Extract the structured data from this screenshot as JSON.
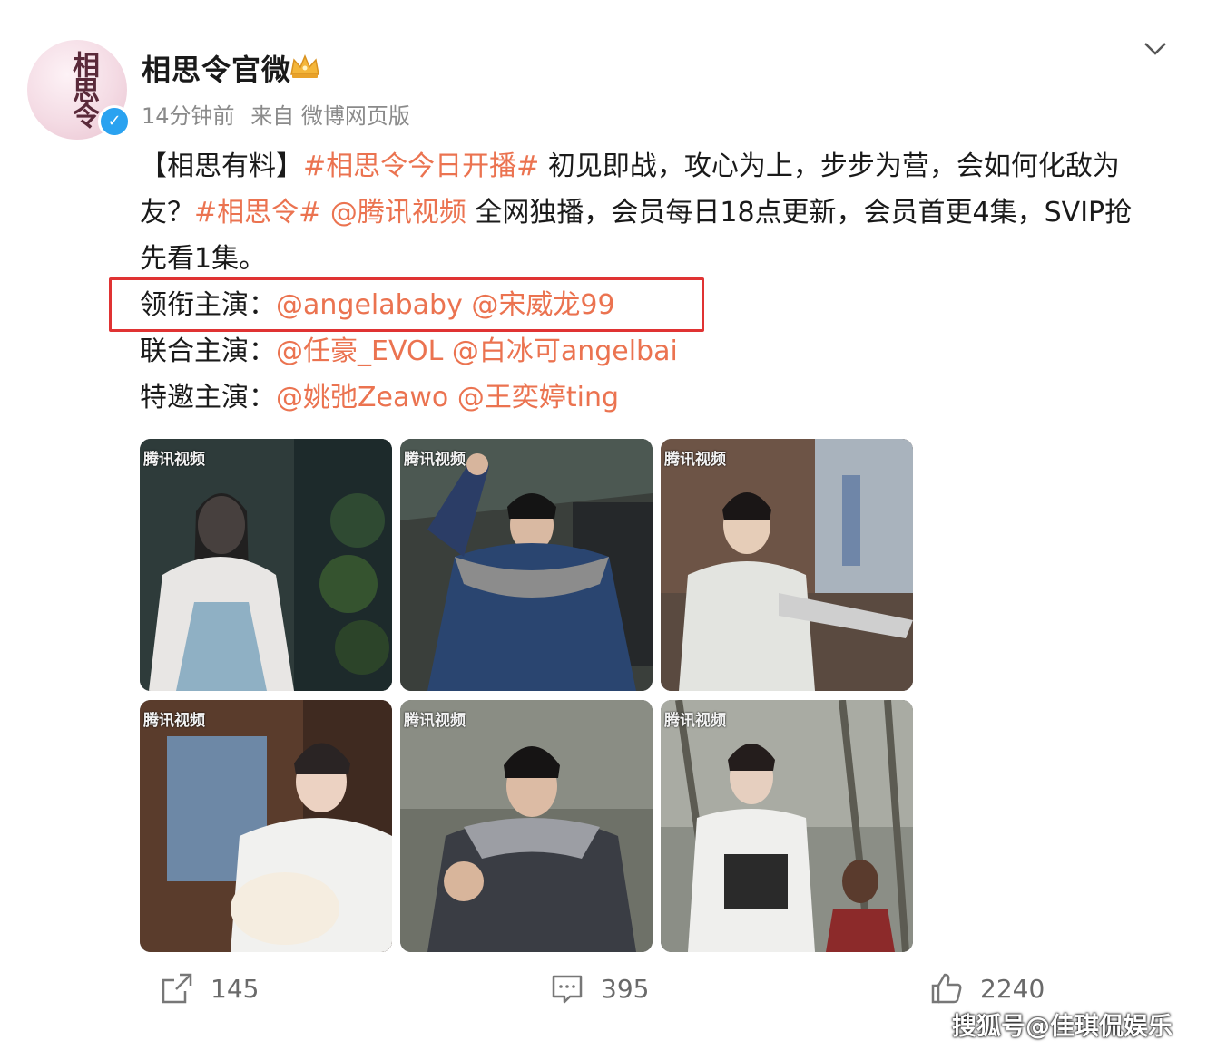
{
  "post": {
    "username": "相思令官微",
    "time": "14分钟前",
    "source": "来自 微博网页版",
    "lines": {
      "l1_a": "【相思有料】",
      "l1_tag": "#相思令今日开播#",
      "l1_b": " 初见即战，攻心为上，步步为营，会如何化敌为",
      "l2_a": "友？",
      "l2_tag": "#相思令#",
      "l2_space": " ",
      "l2_mention": "@腾讯视频",
      "l2_b": " 全网独播，会员每日18点更新，会员首更4集，SVIP抢",
      "l3": "先看1集。"
    },
    "cast": {
      "lead_label": "领衔主演：",
      "lead_1": "@angelababy",
      "lead_2": "@宋威龙99",
      "joint_label": "联合主演：",
      "joint_1": "@任豪_EVOL",
      "joint_2": "@白冰可angelbai",
      "special_label": "特邀主演：",
      "special_1": "@姚弛Zeawo",
      "special_2": "@王奕婷ting"
    }
  },
  "images": [
    {
      "watermark": "腾讯视频"
    },
    {
      "watermark": "腾讯视频"
    },
    {
      "watermark": "腾讯视频"
    },
    {
      "watermark": "腾讯视频"
    },
    {
      "watermark": "腾讯视频"
    },
    {
      "watermark": "腾讯视频"
    }
  ],
  "actions": {
    "repost": "145",
    "comment": "395",
    "like": "2240"
  },
  "watermark": "搜狐号@佳琪侃娱乐",
  "colors": {
    "link": "#eb7350",
    "highlight": "#e03333",
    "verified": "#2aa2f0"
  }
}
